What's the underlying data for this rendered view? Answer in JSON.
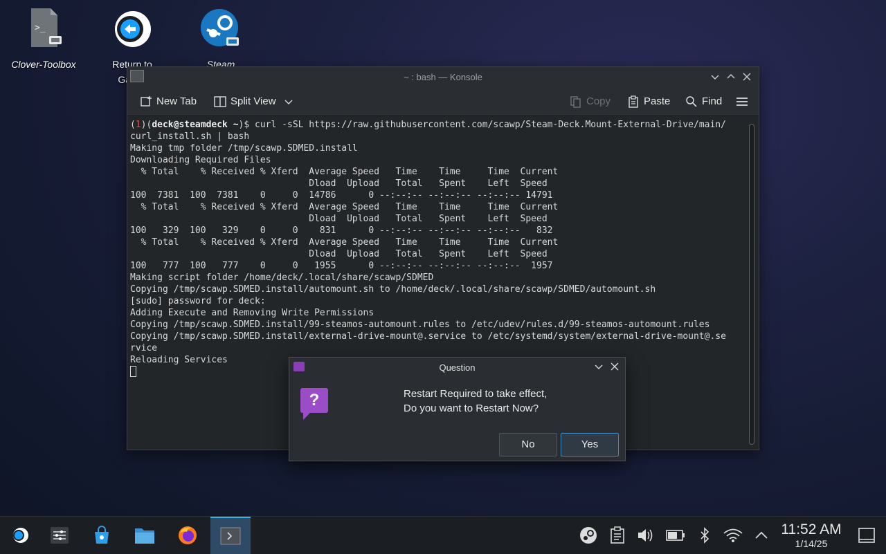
{
  "desktop": {
    "icons": [
      {
        "label": "Clover-Toolbox",
        "icon": "terminal-script-icon"
      },
      {
        "label": "Return to Gaming Mode",
        "visible_label": "Return to\nGamin",
        "icon": "return-arrow-icon"
      },
      {
        "label": "Steam",
        "icon": "steam-icon"
      }
    ]
  },
  "konsole": {
    "title": "~ : bash — Konsole",
    "toolbar": {
      "new_tab": "New Tab",
      "split_view": "Split View",
      "copy": "Copy",
      "paste": "Paste",
      "find": "Find"
    },
    "prompt": {
      "exit_code": "1",
      "user_host": "deck@steamdeck",
      "cwd": "~",
      "command": "$ curl -sSL https://raw.githubusercontent.com/scawp/Steam-Deck.Mount-External-Drive/main/"
    },
    "lines": [
      "curl_install.sh | bash",
      "Making tmp folder /tmp/scawp.SDMED.install",
      "Downloading Required Files",
      "  % Total    % Received % Xferd  Average Speed   Time    Time     Time  Current",
      "                                 Dload  Upload   Total   Spent    Left  Speed",
      "100  7381  100  7381    0     0  14786      0 --:--:-- --:--:-- --:--:-- 14791",
      "  % Total    % Received % Xferd  Average Speed   Time    Time     Time  Current",
      "                                 Dload  Upload   Total   Spent    Left  Speed",
      "100   329  100   329    0     0    831      0 --:--:-- --:--:-- --:--:--   832",
      "  % Total    % Received % Xferd  Average Speed   Time    Time     Time  Current",
      "                                 Dload  Upload   Total   Spent    Left  Speed",
      "100   777  100   777    0     0   1955      0 --:--:-- --:--:-- --:--:--  1957",
      "Making script folder /home/deck/.local/share/scawp/SDMED",
      "Copying /tmp/scawp.SDMED.install/automount.sh to /home/deck/.local/share/scawp/SDMED/automount.sh",
      "[sudo] password for deck:",
      "Adding Execute and Removing Write Permissions",
      "Copying /tmp/scawp.SDMED.install/99-steamos-automount.rules to /etc/udev/rules.d/99-steamos-automount.rules",
      "Copying /tmp/scawp.SDMED.install/external-drive-mount@.service to /etc/systemd/system/external-drive-mount@.se",
      "rvice",
      "Reloading Services"
    ]
  },
  "dialog": {
    "title": "Question",
    "message_line1": "Restart Required to take effect,",
    "message_line2": "Do you want to Restart Now?",
    "no": "No",
    "yes": "Yes"
  },
  "taskbar": {
    "time": "11:52 AM",
    "date": "1/14/25"
  },
  "colors": {
    "accent": "#3daee9",
    "dialog_icon": "#9b4cc7",
    "exit_code": "#e04848"
  }
}
